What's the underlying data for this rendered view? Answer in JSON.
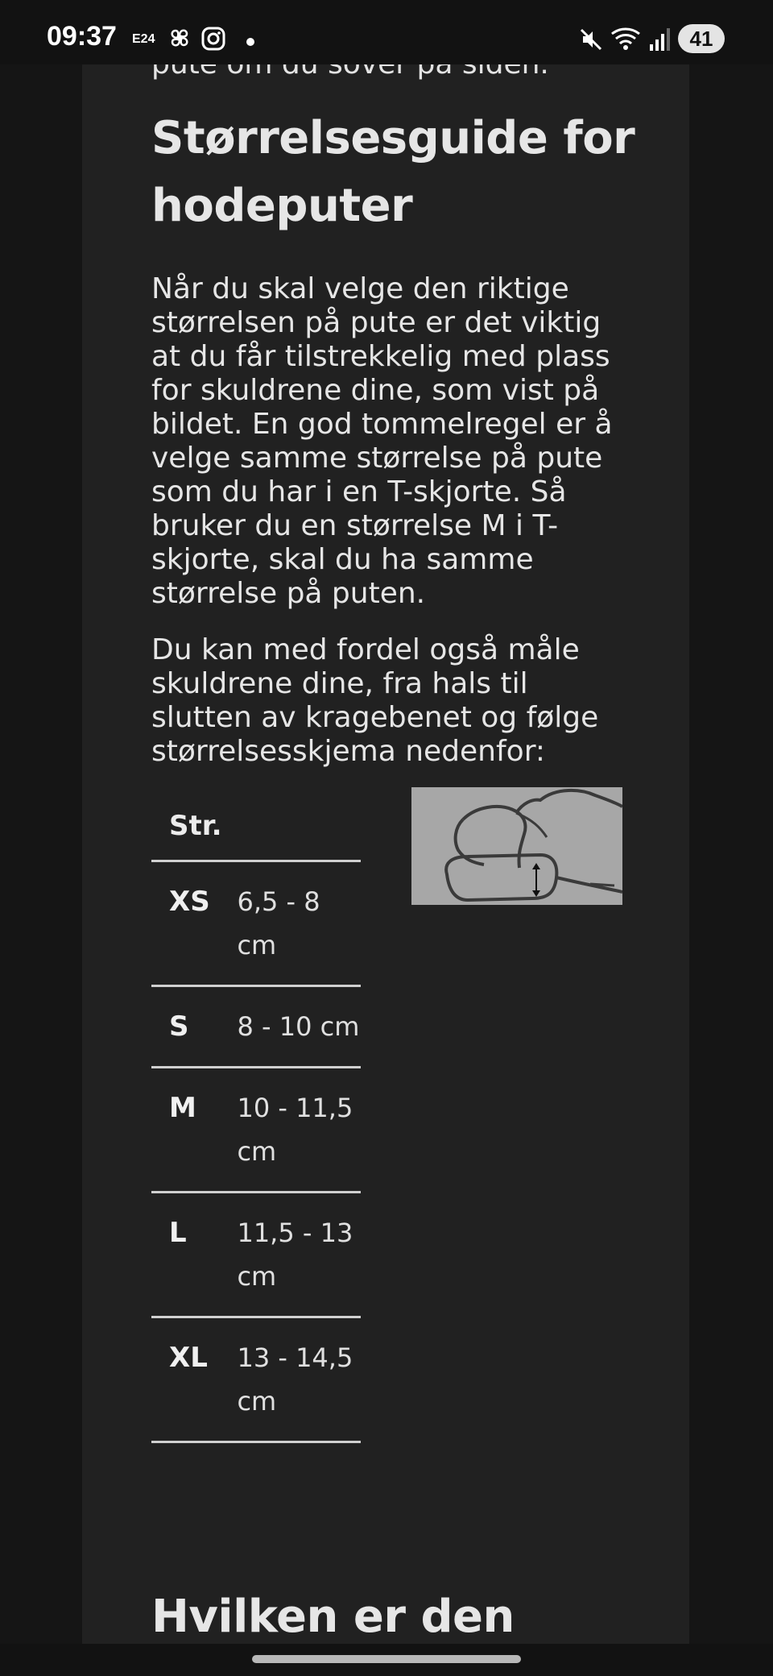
{
  "status_bar": {
    "time": "09:37",
    "app_badge": "E24",
    "battery_level": "41",
    "icons": [
      "e24-icon",
      "pinwheel-icon",
      "instagram-icon",
      "notification-dot-icon",
      "mute-icon",
      "wifi-icon",
      "signal-icon",
      "battery-icon"
    ]
  },
  "article": {
    "clipped_text": "pute om du sover på siden.",
    "heading_1": "Størrelsesguide for hodeputer",
    "paragraph_1": "Når du skal velge den riktige størrelsen på pute er det viktig at du får tilstrekkelig med plass for skuldrene dine, som vist på bildet. En god tommelregel er å velge samme størrelse på pute som du har i en T-skjorte. Så bruker du en størrelse M i T-skjorte, skal du ha samme størrelse på puten.",
    "paragraph_2": "Du kan med fordel også måle skuldrene dine, fra hals til slutten av kragebenet og følge størrelsesskjema nedenfor:",
    "size_table": {
      "header": "Str.",
      "rows": [
        {
          "size": "XS",
          "measure": "6,5 - 8 cm"
        },
        {
          "size": "S",
          "measure": "8 - 10 cm"
        },
        {
          "size": "M",
          "measure": "10 - 11,5 cm"
        },
        {
          "size": "L",
          "measure": "11,5 - 13 cm"
        },
        {
          "size": "XL",
          "measure": "13 - 14,5 cm"
        }
      ]
    },
    "heading_2": "Hvilken er den beste"
  },
  "colors": {
    "page_background": "#151515",
    "content_background": "#212121",
    "text": "#e6e6e6",
    "divider": "#d0d0d0",
    "figure_background": "#a7a7a7"
  }
}
